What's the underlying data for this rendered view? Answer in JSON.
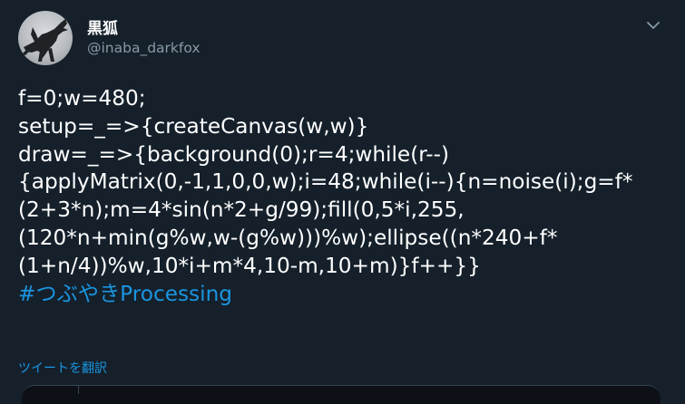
{
  "tweet": {
    "display_name": "黒狐",
    "handle": "@inaba_darkfox",
    "body_lines": [
      "f=0;w=480;",
      "setup=_=>{createCanvas(w,w)}",
      "draw=_=>{background(0);r=4;while(r--)",
      "{applyMatrix(0,-1,1,0,0,w);i=48;while(i--){n=noise(i);g=f*",
      "(2+3*n);m=4*sin(n*2+g/99);fill(0,5*i,255,",
      "(120*n+min(g%w,w-(g%w)))%w);ellipse((n*240+f*",
      "(1+n/4))%w,10*i+m*4,10-m,10+m)}f++}}"
    ],
    "hashtag": "#つぶやきProcessing",
    "translate_label": "ツイートを翻訳",
    "menu_icon": "chevron-down-icon",
    "avatar_icon": "avatar"
  },
  "colors": {
    "background": "#15202b",
    "text": "#ffffff",
    "secondary": "#8899a6",
    "link": "#1b95e0"
  }
}
